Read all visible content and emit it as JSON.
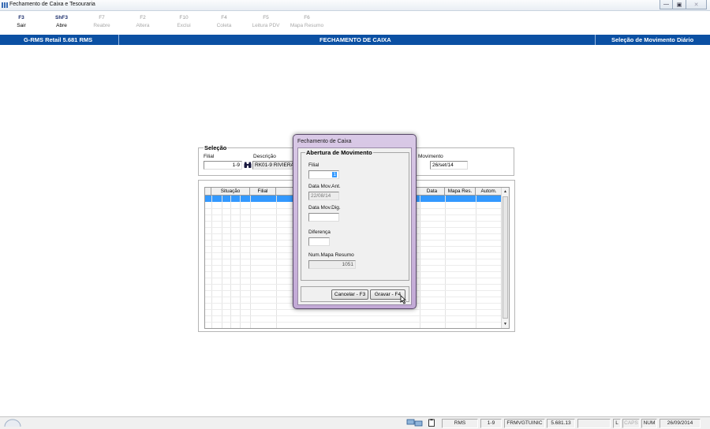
{
  "window": {
    "title": "Fechamento de Caixa e Tesouraria"
  },
  "toolbar": [
    {
      "key": "F3",
      "label": "Sair",
      "enabled": true
    },
    {
      "key": "ShF3",
      "label": "Abre",
      "enabled": true
    },
    {
      "key": "F7",
      "label": "Reabre",
      "enabled": false
    },
    {
      "key": "F2",
      "label": "Altera",
      "enabled": false
    },
    {
      "key": "F10",
      "label": "Exclui",
      "enabled": false
    },
    {
      "key": "F4",
      "label": "Coleta",
      "enabled": false
    },
    {
      "key": "F5",
      "label": "Leitura PDV",
      "enabled": false
    },
    {
      "key": "F6",
      "label": "Mapa Resumo",
      "enabled": false
    }
  ],
  "header": {
    "app": "G-RMS Retail 5.681 RMS",
    "screen": "FECHAMENTO DE CAIXA",
    "context": "Seleção de Movimento Diário"
  },
  "selecao": {
    "legend": "Seleção",
    "filial_label": "Filial",
    "filial_value": "1-9",
    "descricao_label": "Descrição",
    "descricao_value": "RK01-9 RIVIERA",
    "movimento_label": "Movimento",
    "movimento_value": "26/set/14"
  },
  "grid": {
    "columns": [
      "Situação",
      "Filial",
      "Data",
      "Mapa Res.",
      "Autom."
    ]
  },
  "dialog": {
    "title": "Fechamento de Caixa",
    "group": "Abertura de Movimento",
    "filial_label": "Filial",
    "filial_value": "1",
    "data_mov_ant_label": "Data Mov.Ant.",
    "data_mov_ant_value": "22/08/14",
    "data_mov_dig_label": "Data Mov.Dig.",
    "data_mov_dig_value": "",
    "diferenca_label": "Diferença",
    "diferenca_value": "",
    "num_mapa_label": "Num.Mapa Resumo",
    "num_mapa_value": "1051",
    "cancel_label": "Cancelar - F3",
    "save_label": "Gravar - F4"
  },
  "statusbar": {
    "user": "RMS",
    "filial": "1-9",
    "form": "FRMVGTUINIC",
    "version": "5.681.13",
    "l": "L",
    "caps": "CAPS",
    "num": "NUM",
    "date": "26/09/2014"
  }
}
